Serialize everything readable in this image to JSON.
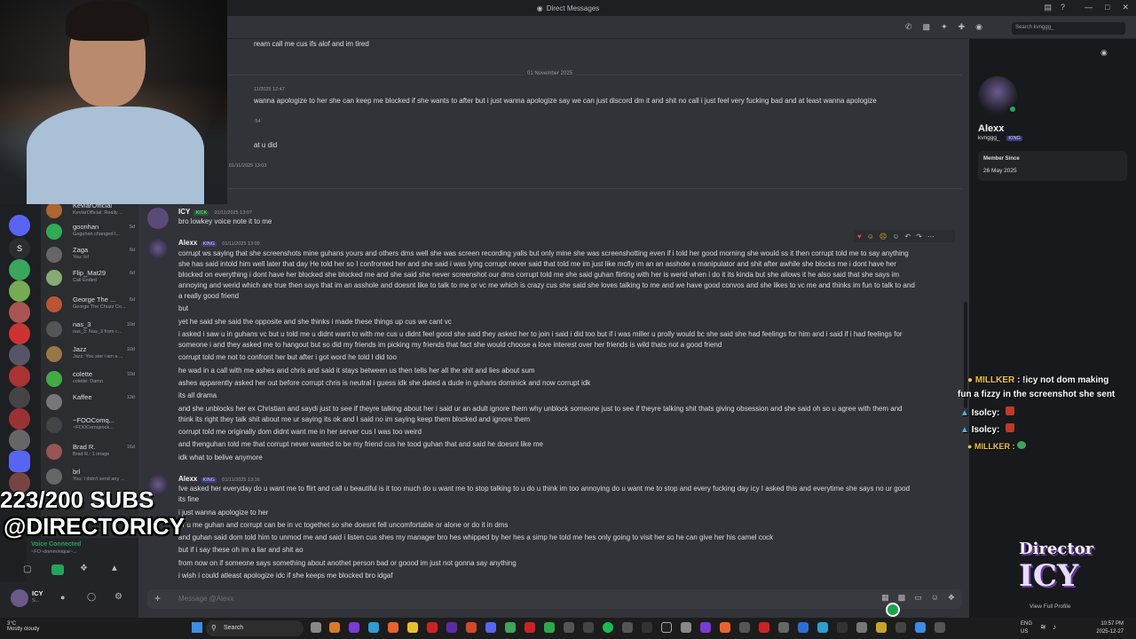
{
  "window": {
    "title": "Direct Messages"
  },
  "search": {
    "placeholder": "Search kvnggg_"
  },
  "date_divider": "01 November 2025",
  "messages_top": [
    {
      "text": "ream call me cus ifs alof and im tired"
    },
    {
      "ts": "11/2025 12:47",
      "text": "wanna apologize to her she can keep me blocked if she wants to after but i just wanna apologize say we can just discord dm it and shit no call i just feel very fucking bad and at least wanna apologize"
    },
    {
      "ts": ":54",
      "text": "at u did"
    },
    {
      "ts": "01/11/2025 13:03"
    }
  ],
  "msg_icy": {
    "author": "ICY",
    "tag": "KICK",
    "ts": "01/11/2025 13:07",
    "text": "bro lowkey voice note it to me"
  },
  "msg_alexx1": {
    "author": "Alexx",
    "tag": "KING",
    "ts": "01/11/2025 13:09",
    "lines": [
      "corrupt ws saying that she screenshots mine guhans yours and others dms well she was screen recording yalls but only mine she was screenshotting even if i told her good morning she would ss it then corrupt told me to say anything",
      "she has said intold him well later that day He told her so I confronted her and she said i was lying corrupt never said that told me im just like mcfly im an an asshole a manipulator and shit after awhile she blocks me i dont have her",
      "blocked on everything i dont have her blocked she blocked me and she said she never screenshot our dms corrupt told me she said guhan flirting with her is werid when i do it its kinda but she allows it he also said that she says im",
      "annoying and werid which are true then says that im an asshole and doesnt like to talk to me or vc me which is crazy cus she said she loves talking to me and we have good convos and she likes to vc me and thinks im fun to talk to and",
      "a really good friend",
      "but",
      "yet he said she said the opposite and she thinks i made these things up cus we cant vc",
      "i asked i saw u in guhans vc but u told me u didnt want to with me cus u didnt feel good she said they asked her to join i said i did too but if i was miller u prolly would bc she said she had feelings for him and i said if i had feelings for",
      "someone i and they asked me to hangout but so did my friends im picking my friends that fact she would choose a love interest over her friends is wild thats not a good friend",
      "corrupt told me not to confront her but after i got word he told I did too",
      "he wad in a call with me ashes and chris and said it stays between us then tells her all the shit and lies about sum",
      "ashes apparently asked her out before corrupt chris is neutral i guess idk she dated a dude in guhans dominick and now corrupt idk",
      "its all drama",
      "and she unblocks her ex Christian and saydi just to see if theyre talking about her i said ur an adult ignore them why unblock someone just to see if theyre talking shit thats giving obsession and she said oh so u agree with them and",
      "think its right they talk shit about me ur saying its ok and I said no im saying keep them blocked and ignore them",
      "corrupt told me originally dom didnt want me in her server cus I was too weird",
      "and thenguhan told me that corrupt never wanted to be my friend cus he tood guhan that and said he doesnt like me",
      "idk what to belive anymore"
    ]
  },
  "msg_alexx2": {
    "author": "Alexx",
    "tag": "KING",
    "ts": "01/11/2025 13:16",
    "lines": [
      "Ive asked her everyday do u want me to flirt and call u beautiful is it too much do u want me to stop talking to u do u think im too annoying do u want me to stop and every fucking day icy I asked this and everytime she says no ur good",
      "its fine",
      "i just wanna apologize to her",
      "or u me guhan and corrupt can be in vc togethet so she doesnt fell uncomfortable or alone or do it in dms",
      "and guhan said dom told him to unmod me and said i listen cus shes my manager bro hes whipped by her hes a simp he told me hes only going to visit her so he can give her his camel cock",
      "but if i say these oh im a liar and shit ao",
      "from now on if someone says something about anothet person bad or goood im just not gonna say anything",
      "i wish i could atleast apologize idc if she keeps me blocked bro idgaf"
    ]
  },
  "composer": {
    "placeholder": "Message @Alexx"
  },
  "profile": {
    "name": "Alexx",
    "username": "kvnggg_",
    "tag": "KING",
    "member_since_label": "Member Since",
    "member_since": "26 May 2025",
    "view_full": "View Full Profile"
  },
  "dms": [
    {
      "name": "KevlarOfficial",
      "sub": "KevlarOfficial: Really ..."
    },
    {
      "name": "goonhan",
      "sub": "Gaguhan changed t...",
      "time": "5d"
    },
    {
      "name": "Zaga",
      "sub": "You: lol",
      "time": "6d"
    },
    {
      "name": "Flip_Mat29",
      "sub": "Call Ended",
      "time": "6d"
    },
    {
      "name": "George The ...",
      "sub": "George The Chuzz Co...",
      "time": "6d"
    },
    {
      "name": "nas_3",
      "sub": "nas_3: Nas_3 from c...",
      "time": "10d"
    },
    {
      "name": "Jazz",
      "sub": "Jazz: You see i am a ...",
      "time": "10d"
    },
    {
      "name": "colette",
      "sub": "colette: Damn",
      "time": "10d"
    },
    {
      "name": "Kaffee",
      "sub": "",
      "time": "13d"
    },
    {
      "name": "~FOOComq...",
      "sub": "~FOOComqsock...",
      "time": ""
    },
    {
      "name": "Brad R.",
      "sub": "Brad R.: 1 image",
      "time": "16d"
    },
    {
      "name": "brl",
      "sub": "You: I didn't send any ...",
      "time": ""
    }
  ],
  "voice": {
    "status": "Voice Connected",
    "sub": "~FO~domminique~..."
  },
  "user": {
    "name": "ICY",
    "status": "S..."
  },
  "overlay": {
    "subs": "223/200 SUBS",
    "handle": "@DIRECTORICY",
    "logo_top": "Director",
    "logo_bottom": "ICY"
  },
  "stream_chat": [
    {
      "user": "MILLKER",
      "text": ": !icy not dom making"
    },
    {
      "user": "",
      "text": "fun a fizzy in the screenshot she sent"
    },
    {
      "user": "Isolcy",
      "text": ":"
    },
    {
      "user": "Isolcy",
      "text": ":"
    },
    {
      "user": "MILLKER",
      "text": ":"
    }
  ],
  "taskbar": {
    "weather_temp": "3°C",
    "weather_desc": "Mostly cloudy",
    "search": "Search",
    "lang": "ENG",
    "region": "US",
    "time": "10:57 PM",
    "date": "2025-12-27"
  },
  "colors": {
    "online": "#23a55a",
    "accent": "#5865f2",
    "overlay_user": "#f0c14b"
  }
}
